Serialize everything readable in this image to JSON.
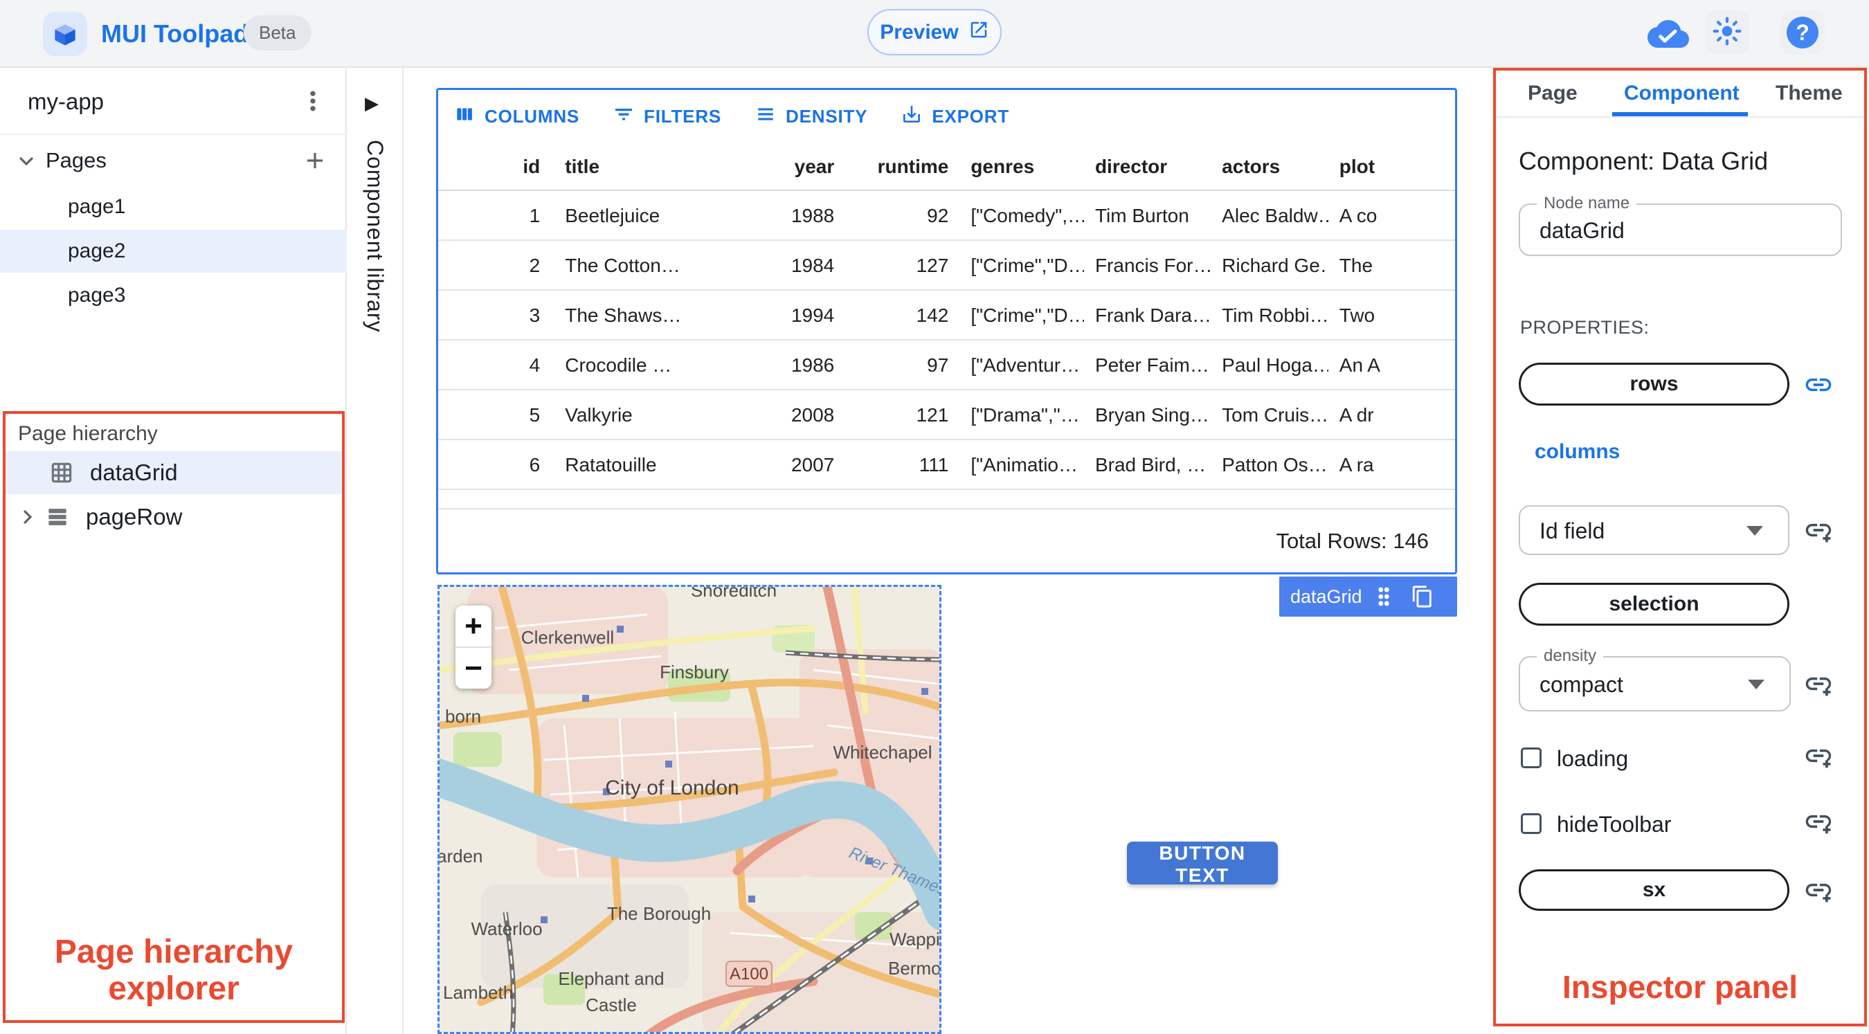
{
  "colors": {
    "accent_blue": "#1a73e8",
    "grid_border_blue": "#2e7cf6",
    "chip_blue": "#4b80ee",
    "button_blue": "#4377d3",
    "annotation_red": "#ea4a31",
    "selected_row_bg": "#e9f0fc"
  },
  "app_bar": {
    "title": "MUI Toolpad",
    "beta_badge": "Beta",
    "preview_button": "Preview"
  },
  "sidebar": {
    "project_name": "my-app",
    "pages_label": "Pages",
    "pages": [
      {
        "label": "page1",
        "selected": false
      },
      {
        "label": "page2",
        "selected": true
      },
      {
        "label": "page3",
        "selected": false
      }
    ]
  },
  "component_library": {
    "label": "Component library"
  },
  "hierarchy": {
    "title": "Page hierarchy",
    "items": [
      {
        "label": "dataGrid",
        "selected": true
      },
      {
        "label": "pageRow",
        "selected": false
      }
    ],
    "annotation_line1": "Page hierarchy",
    "annotation_line2": "explorer"
  },
  "grid": {
    "toolbar": {
      "columns": "COLUMNS",
      "filters": "FILTERS",
      "density": "DENSITY",
      "export": "EXPORT"
    },
    "columns": [
      "id",
      "title",
      "year",
      "runtime",
      "genres",
      "director",
      "actors",
      "plot"
    ],
    "rows": [
      [
        "1",
        "Beetlejuice",
        "1988",
        "92",
        "[\"Comedy\",…",
        "Tim Burton",
        "Alec Baldw…",
        "A co"
      ],
      [
        "2",
        "The Cotton…",
        "1984",
        "127",
        "[\"Crime\",\"D…",
        "Francis For…",
        "Richard Ge…",
        "The"
      ],
      [
        "3",
        "The Shaws…",
        "1994",
        "142",
        "[\"Crime\",\"D…",
        "Frank Dara…",
        "Tim Robbi…",
        "Two"
      ],
      [
        "4",
        "Crocodile …",
        "1986",
        "97",
        "[\"Adventur…",
        "Peter Faim…",
        "Paul Hoga…",
        "An A"
      ],
      [
        "5",
        "Valkyrie",
        "2008",
        "121",
        "[\"Drama\",\"…",
        "Bryan Sing…",
        "Tom Cruis…",
        "A dr"
      ],
      [
        "6",
        "Ratatouille",
        "2007",
        "111",
        "[\"Animatio…",
        "Brad Bird, …",
        "Patton Os…",
        "A ra"
      ]
    ],
    "footer": "Total Rows: 146",
    "selection_chip": "dataGrid"
  },
  "map": {
    "zoom_in": "+",
    "zoom_out": "−",
    "road_badge": "A100",
    "labels": {
      "shoreditch": "Shoreditch",
      "clerkenwell": "Clerkenwell",
      "finsbury": "Finsbury",
      "holborn_partial": "born",
      "whitechapel": "Whitechapel",
      "city_of_london": "City of London",
      "garden_partial": "arden",
      "wapping": "Wapping",
      "waterloo": "Waterloo",
      "the_borough": "The Borough",
      "lambeth": "Lambeth",
      "elephant_line1": "Elephant and",
      "elephant_line2": "Castle",
      "bermondsey_partial": "Bermondse",
      "river": "River Thames"
    }
  },
  "button": {
    "label": "BUTTON TEXT"
  },
  "inspector": {
    "tabs": {
      "page": "Page",
      "component": "Component",
      "theme": "Theme"
    },
    "heading": "Component: Data Grid",
    "node_name": {
      "label": "Node name",
      "value": "dataGrid"
    },
    "properties_label": "PROPERTIES:",
    "rows_prop": "rows",
    "columns_prop": "columns",
    "id_field": {
      "value": "Id field"
    },
    "selection_prop": "selection",
    "density": {
      "label": "density",
      "value": "compact"
    },
    "loading_prop": "loading",
    "hide_toolbar_prop": "hideToolbar",
    "sx_prop": "sx",
    "annotation": "Inspector panel"
  }
}
